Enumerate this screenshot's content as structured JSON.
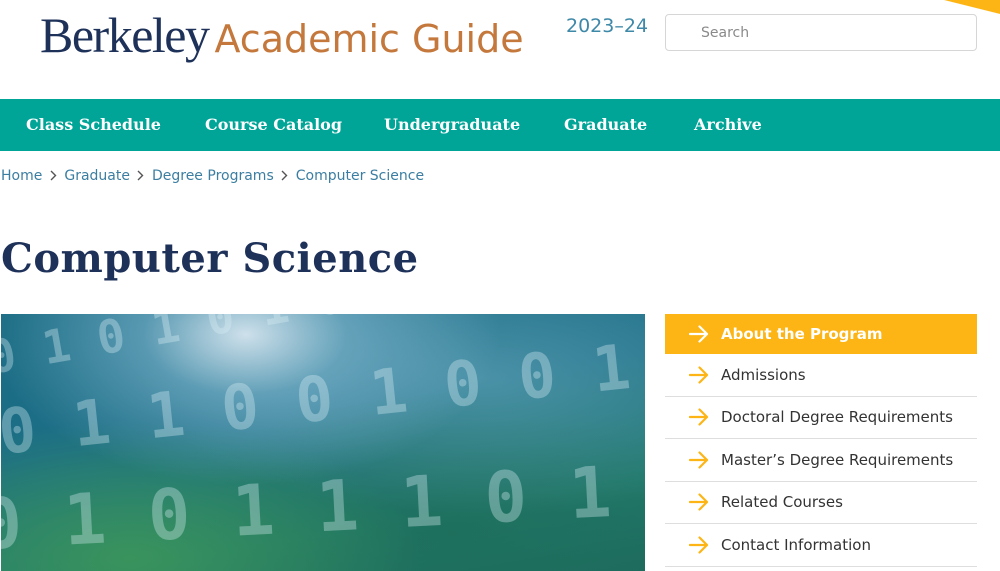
{
  "header": {
    "logo_berkeley": "Berkeley",
    "logo_guide": "Academic Guide",
    "logo_year": "2023–24",
    "search_placeholder": "Search"
  },
  "nav": {
    "items": [
      {
        "label": "Class Schedule"
      },
      {
        "label": "Course Catalog"
      },
      {
        "label": "Undergraduate"
      },
      {
        "label": "Graduate"
      },
      {
        "label": "Archive"
      }
    ]
  },
  "breadcrumb": {
    "items": [
      {
        "label": "Home"
      },
      {
        "label": "Graduate"
      },
      {
        "label": "Degree Programs"
      },
      {
        "label": "Computer Science"
      }
    ]
  },
  "page": {
    "title": "Computer Science"
  },
  "sidebar": {
    "items": [
      {
        "label": "About the Program",
        "active": true
      },
      {
        "label": "Admissions",
        "active": false
      },
      {
        "label": "Doctoral Degree Requirements",
        "active": false
      },
      {
        "label": "Master’s Degree Requirements",
        "active": false
      },
      {
        "label": "Related Courses",
        "active": false
      },
      {
        "label": "Contact Information",
        "active": false
      }
    ]
  },
  "colors": {
    "nav_background": "#00a598",
    "title_navy": "#1e3159",
    "accent_gold": "#fdb515",
    "logo_orange": "#c4783c",
    "link_blue": "#3b7ea1"
  },
  "icons": {
    "breadcrumb_separator": "chevron-right-icon",
    "sidebar_bullet": "arrow-right-icon"
  }
}
